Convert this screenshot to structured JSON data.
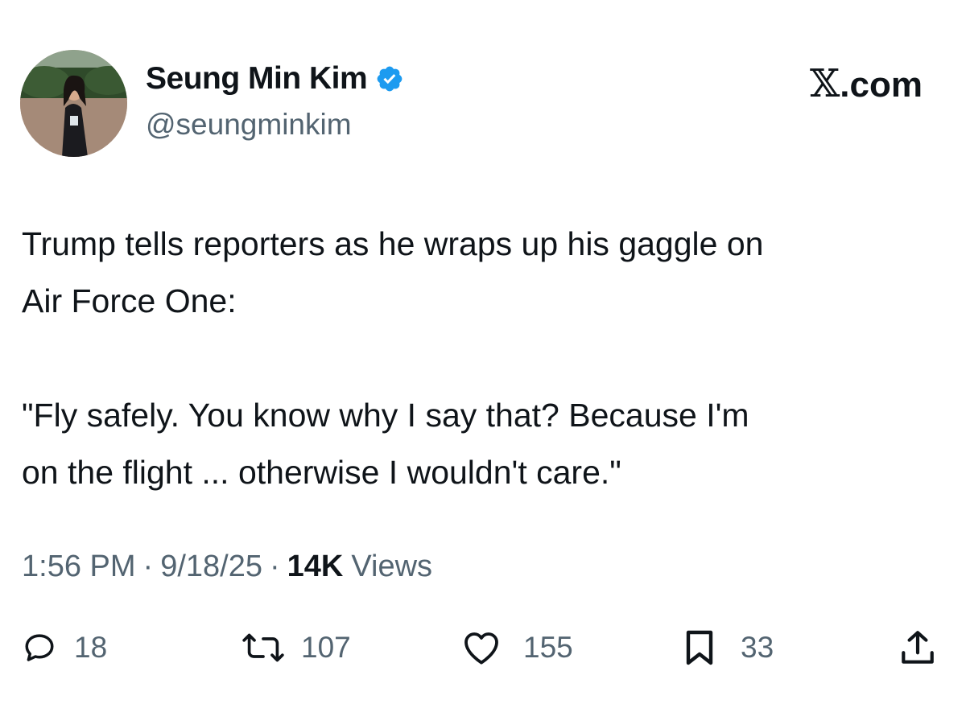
{
  "author": {
    "display_name": "Seung Min Kim",
    "handle": "@seungminkim",
    "verified": true,
    "verified_color": "#1d9bf0"
  },
  "brand": {
    "glyph": "𝕏",
    "suffix": ".com"
  },
  "tweet": {
    "paragraphs": [
      "Trump tells reporters as he wraps up his gaggle on\nAir Force One:",
      "\"Fly safely. You know why I say that? Because I'm\non the flight ... otherwise I wouldn't care.\""
    ]
  },
  "meta": {
    "time": "1:56 PM",
    "date": "9/18/25",
    "views_count": "14K",
    "views_label": "Views",
    "separator": "·"
  },
  "actions": {
    "replies": "18",
    "reposts": "107",
    "likes": "155",
    "bookmarks": "33"
  },
  "icons": {
    "reply": "reply-icon",
    "repost": "repost-icon",
    "like": "heart-icon",
    "bookmark": "bookmark-icon",
    "share": "share-icon",
    "verified": "verified-badge-icon"
  },
  "colors": {
    "text": "#0f1419",
    "secondary": "#536471",
    "accent": "#1d9bf0"
  }
}
